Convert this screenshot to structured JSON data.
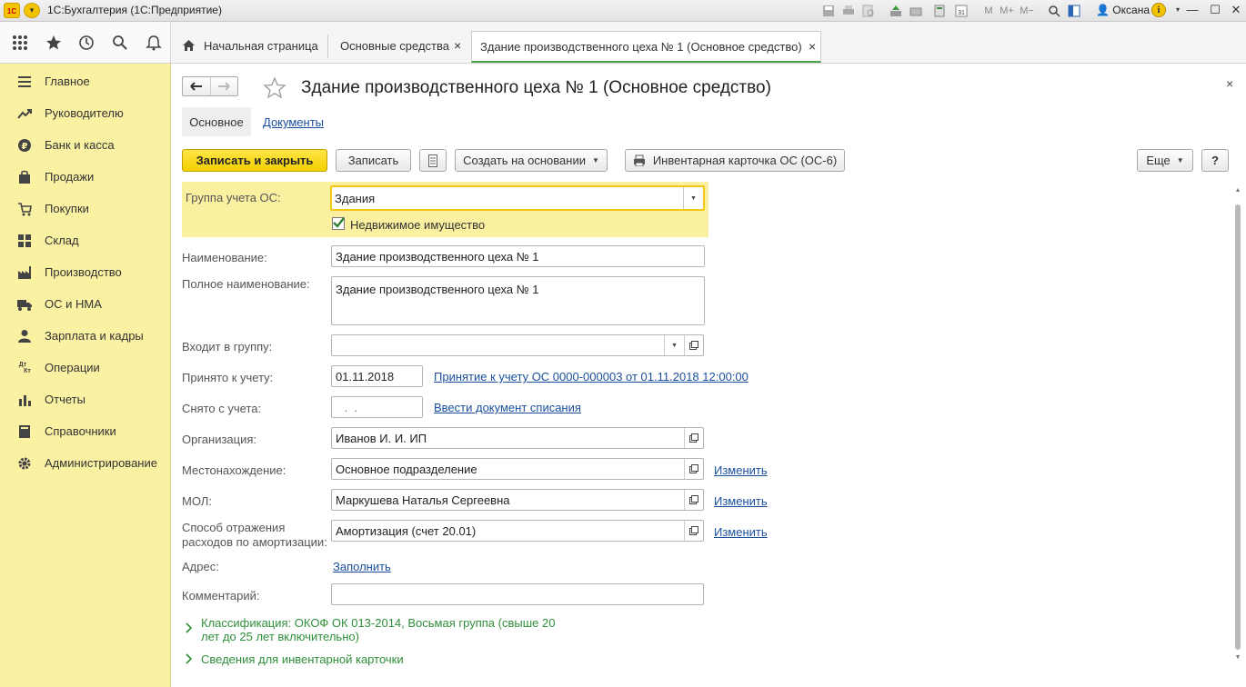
{
  "window": {
    "app_title": "1С:Бухгалтерия  (1С:Предприятие)",
    "logo_text": "1С",
    "user": "Оксана",
    "toolbar_icons": [
      "save-icon",
      "print-icon",
      "preview-icon",
      "upload-icon",
      "scan-icon",
      "calculator-icon",
      "calendar-icon",
      "memory-m-icon",
      "memory-plus-icon",
      "memory-minus-icon",
      "zoom-icon",
      "panel-icon"
    ],
    "calendar_day": "31",
    "memory_labels": [
      "M",
      "M+",
      "M−"
    ]
  },
  "tabs": [
    {
      "label": "Начальная страница",
      "icon": "home-icon"
    },
    {
      "label": "Основные средства",
      "closable": true
    },
    {
      "label": "Здание производственного цеха № 1 (Основное средство)",
      "closable": true,
      "active": true
    }
  ],
  "close_glyph": "×",
  "sidebar": {
    "items": [
      {
        "label": "Главное",
        "icon": "menu-lines-icon"
      },
      {
        "label": "Руководителю",
        "icon": "trend-icon"
      },
      {
        "label": "Банк и касса",
        "icon": "ruble-icon"
      },
      {
        "label": "Продажи",
        "icon": "bag-icon"
      },
      {
        "label": "Покупки",
        "icon": "cart-icon"
      },
      {
        "label": "Склад",
        "icon": "warehouse-icon"
      },
      {
        "label": "Производство",
        "icon": "factory-icon"
      },
      {
        "label": "ОС и НМА",
        "icon": "truck-icon"
      },
      {
        "label": "Зарплата и кадры",
        "icon": "person-icon"
      },
      {
        "label": "Операции",
        "icon": "dt-kt-icon",
        "icon_text_top": "Дт",
        "icon_text_bottom": "Кт"
      },
      {
        "label": "Отчеты",
        "icon": "bar-chart-icon"
      },
      {
        "label": "Справочники",
        "icon": "book-icon"
      },
      {
        "label": "Администрирование",
        "icon": "gear-icon"
      }
    ]
  },
  "form": {
    "title": "Здание производственного цеха № 1 (Основное средство)",
    "subtabs": {
      "main": "Основное",
      "documents": "Документы"
    },
    "toolbar": {
      "save_close": "Записать и закрыть",
      "save": "Записать",
      "create_based": "Создать на основании",
      "inventory_card": "Инвентарная карточка ОС (ОС-6)",
      "more": "Еще",
      "help": "?"
    },
    "fields": {
      "group_label": "Группа учета ОС:",
      "group_value": "Здания",
      "real_estate_label": "Недвижимое имущество",
      "real_estate_checked": true,
      "name_label": "Наименование:",
      "name_value": "Здание производственного цеха № 1",
      "full_name_label": "Полное наименование:",
      "full_name_value": "Здание производственного цеха № 1",
      "parent_group_label": "Входит в группу:",
      "parent_group_value": "",
      "accepted_label": "Принято к учету:",
      "accepted_date": "01.11.2018",
      "accepted_link": "Принятие к учету ОС 0000-000003 от 01.11.2018 12:00:00",
      "removed_label": "Снято с учета:",
      "removed_date": " .  .",
      "removed_link": "Ввести документ списания",
      "org_label": "Организация:",
      "org_value": "Иванов И. И. ИП",
      "location_label": "Местонахождение:",
      "location_value": "Основное подразделение",
      "mol_label": "МОЛ:",
      "mol_value": "Маркушева Наталья Сергеевна",
      "depr_label_1": "Способ отражения",
      "depr_label_2": "расходов по амортизации:",
      "depr_value": "Амортизация (счет 20.01)",
      "change_link": "Изменить",
      "address_label": "Адрес:",
      "address_link": "Заполнить",
      "comment_label": "Комментарий:",
      "comment_value": ""
    },
    "groups": {
      "classification_1": "Классификация: ОКОФ ОК 013-2014, Восьмая группа (свыше 20",
      "classification_2": "лет до 25 лет включительно)",
      "inventory": "Сведения для инвентарной карточки"
    }
  },
  "colors": {
    "sidebar_bg": "#fbf1a3",
    "primary_button": "#f5d300",
    "link": "#1a4fa0",
    "group_header": "#2f8f3a",
    "active_tab_underline": "#4aa24a"
  }
}
